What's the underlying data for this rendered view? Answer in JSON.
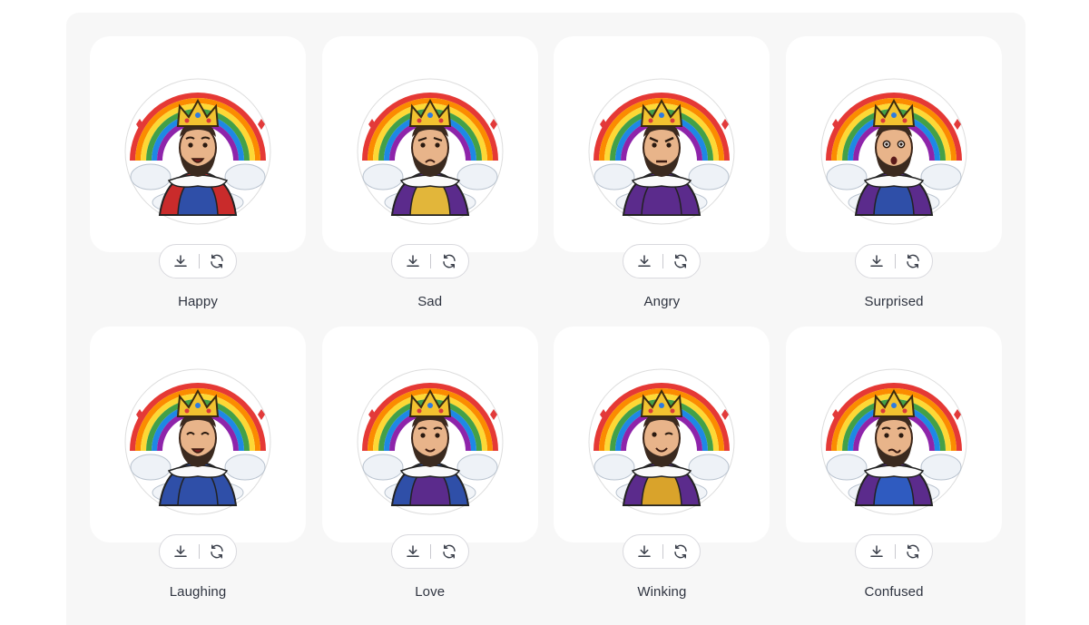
{
  "colors": {
    "panel_bg": "#f7f7f7",
    "card_bg": "#ffffff",
    "label_text": "#2f3440",
    "icon_stroke": "#3a3f4a"
  },
  "stickers": [
    {
      "label": "Happy",
      "mood": "happy",
      "robe": "#2f4fa8",
      "cape": "#c92b2b"
    },
    {
      "label": "Sad",
      "mood": "sad",
      "robe": "#e2b63a",
      "cape": "#5b2b8c"
    },
    {
      "label": "Angry",
      "mood": "angry",
      "robe": "#5b2b8c",
      "cape": "#5b2b8c"
    },
    {
      "label": "Surprised",
      "mood": "surprised",
      "robe": "#2f4fa8",
      "cape": "#5b2b8c"
    },
    {
      "label": "Laughing",
      "mood": "laughing",
      "robe": "#2f4fa8",
      "cape": "#2f4fa8"
    },
    {
      "label": "Love",
      "mood": "love",
      "robe": "#5b2b8c",
      "cape": "#2f4fa8"
    },
    {
      "label": "Winking",
      "mood": "winking",
      "robe": "#d9a32b",
      "cape": "#5b2b8c"
    },
    {
      "label": "Confused",
      "mood": "confused",
      "robe": "#2f5bc0",
      "cape": "#5b2b8c"
    }
  ],
  "actions": {
    "download_icon": "download-icon",
    "regenerate_icon": "refresh-icon"
  }
}
